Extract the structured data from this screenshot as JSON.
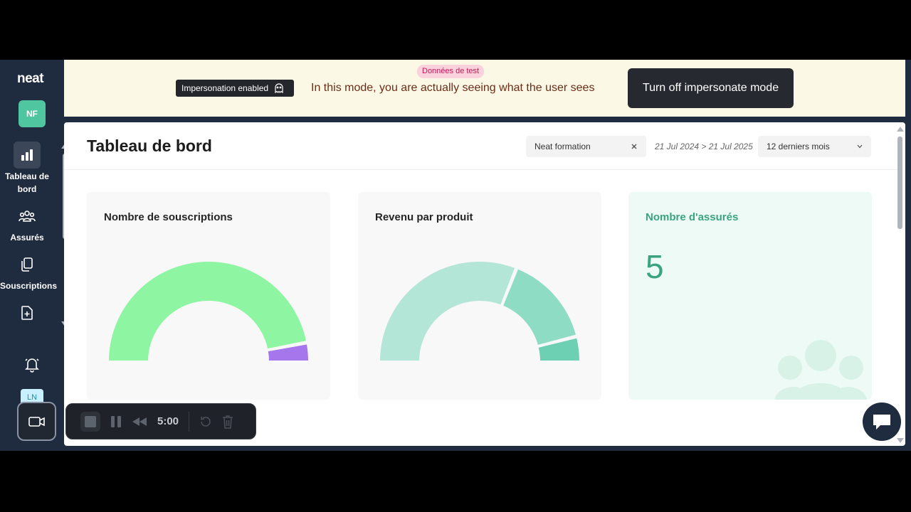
{
  "sidebar": {
    "logo": "neat",
    "user_initials": "NF",
    "items": [
      {
        "label": "Tableau de bord",
        "icon": "bar-chart-icon",
        "active": true
      },
      {
        "label": "Assurés",
        "icon": "users-icon",
        "active": false
      },
      {
        "label": "Souscriptions",
        "icon": "documents-icon",
        "active": false
      },
      {
        "label": "",
        "icon": "add-document-icon",
        "active": false
      }
    ],
    "bottom_initials": "LN"
  },
  "banner": {
    "test_badge": "Données de test",
    "impersonation_chip": "Impersonation enabled",
    "message": "In this mode, you are actually seeing what the user sees",
    "turn_off_label": "Turn off impersonate mode"
  },
  "header": {
    "title": "Tableau de bord",
    "company_filter": "Neat formation",
    "date_range": "21 Jul 2024 > 21 Jul 2025",
    "period": "12 derniers mois"
  },
  "cards": {
    "subscriptions": {
      "title": "Nombre de souscriptions"
    },
    "revenue": {
      "title": "Revenu par produit"
    },
    "insured": {
      "title": "Nombre d'assurés",
      "value": "5"
    }
  },
  "recorder": {
    "time": "5:00"
  },
  "colors": {
    "accent_green": "#3aa481",
    "gauge_green": "#8ef5a2",
    "gauge_purple": "#a576ec",
    "teal_light": "#b3e6d7",
    "teal_mid": "#8fdcc5",
    "teal_dark": "#6dd0b2"
  },
  "chart_data": [
    {
      "type": "pie",
      "title": "Nombre de souscriptions",
      "values": [
        94,
        6
      ]
    },
    {
      "type": "pie",
      "title": "Revenu par produit",
      "values": [
        62,
        30,
        8
      ]
    }
  ]
}
